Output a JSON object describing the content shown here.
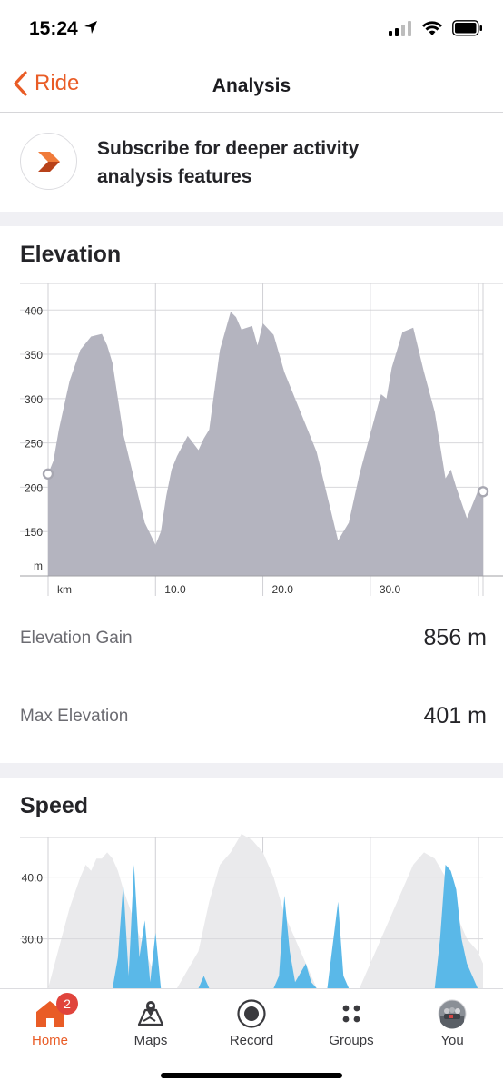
{
  "status": {
    "time": "15:24"
  },
  "nav": {
    "back_label": "Ride",
    "title": "Analysis"
  },
  "subscribe": {
    "text": "Subscribe for deeper activity analysis features"
  },
  "elevation": {
    "title": "Elevation",
    "stats": [
      {
        "label": "Elevation Gain",
        "value": "856 m"
      },
      {
        "label": "Max Elevation",
        "value": "401 m"
      }
    ]
  },
  "speed": {
    "title": "Speed"
  },
  "tabs": [
    {
      "label": "Home",
      "icon": "home-icon",
      "active": true,
      "badge": "2"
    },
    {
      "label": "Maps",
      "icon": "maps-icon",
      "active": false
    },
    {
      "label": "Record",
      "icon": "record-icon",
      "active": false
    },
    {
      "label": "Groups",
      "icon": "groups-icon",
      "active": false
    },
    {
      "label": "You",
      "icon": "avatar-icon",
      "active": false
    }
  ],
  "colors": {
    "accent": "#e95c26",
    "elevation_fill": "#b4b4bf",
    "speed_fill": "#5ab8e8",
    "speed_bg_fill": "#eaeaec",
    "badge": "#e0443c"
  },
  "chart_data": [
    {
      "type": "area",
      "title": "Elevation",
      "xlabel": "km",
      "ylabel": "m",
      "x_ticks": [
        "km",
        "10.0",
        "20.0",
        "30.0"
      ],
      "y_ticks": [
        150,
        200,
        250,
        300,
        350,
        400
      ],
      "xlim": [
        0,
        40.5
      ],
      "ylim": [
        100,
        430
      ],
      "grid": true,
      "x": [
        0,
        0.5,
        1,
        2,
        3,
        4,
        5,
        5.5,
        6,
        6.5,
        7,
        8,
        9,
        10,
        10.5,
        11,
        11.5,
        12,
        13,
        14,
        14.5,
        15,
        16,
        17,
        17.5,
        18,
        19,
        19.5,
        20,
        21,
        22,
        23,
        24,
        25,
        26,
        27,
        28,
        29,
        30,
        31,
        31.5,
        32,
        33,
        34,
        35,
        36,
        37,
        37.5,
        38,
        39,
        40,
        40.5
      ],
      "values": [
        215,
        230,
        265,
        320,
        355,
        370,
        373,
        360,
        340,
        300,
        260,
        210,
        160,
        135,
        150,
        190,
        220,
        235,
        258,
        242,
        255,
        265,
        355,
        398,
        392,
        378,
        382,
        360,
        385,
        372,
        330,
        300,
        270,
        240,
        190,
        140,
        160,
        215,
        260,
        305,
        300,
        335,
        375,
        380,
        330,
        285,
        210,
        220,
        200,
        165,
        195,
        195
      ]
    },
    {
      "type": "area",
      "title": "Speed",
      "x_ticks": [],
      "y_ticks": [
        30.0,
        40.0
      ],
      "xlim": [
        0,
        40.5
      ],
      "ylim": [
        22,
        47
      ],
      "grid": true,
      "series": [
        {
          "x": [
            0,
            2,
            3,
            3.5,
            4,
            4.5,
            5,
            5.5,
            6,
            6.5,
            7,
            8,
            9,
            10.5,
            11,
            12,
            14,
            15,
            16,
            17,
            18,
            19,
            20,
            21,
            22,
            23,
            24,
            25,
            26,
            27,
            28,
            29,
            30,
            31,
            32,
            33,
            34,
            35,
            36,
            37,
            38,
            39,
            40,
            40.5
          ],
          "values": [
            22,
            35,
            40,
            42,
            41,
            43,
            43,
            44,
            43,
            41,
            38,
            33,
            28,
            22,
            22,
            22,
            28,
            36,
            42,
            44,
            47,
            46,
            44,
            40,
            34,
            30,
            26,
            22,
            22,
            22,
            22,
            22,
            26,
            30,
            34,
            38,
            42,
            44,
            43,
            40,
            34,
            30,
            28,
            26
          ]
        },
        {
          "x": [
            0,
            6,
            6.5,
            7,
            7.5,
            8,
            8.5,
            9,
            9.5,
            10,
            10.5,
            11,
            14,
            14.5,
            15,
            21,
            21.5,
            22,
            22.5,
            23,
            24,
            24.5,
            25,
            26,
            27,
            27.5,
            28,
            30,
            36,
            36.5,
            37,
            37.5,
            38,
            38.5,
            39,
            39.5,
            40,
            40.5
          ],
          "values": [
            22,
            22,
            27,
            39,
            24,
            42,
            27,
            33,
            23,
            31,
            22,
            22,
            22,
            24,
            22,
            22,
            24,
            37,
            28,
            23,
            26,
            23,
            22,
            22,
            36,
            24,
            22,
            22,
            22,
            30,
            42,
            41,
            38,
            30,
            26,
            24,
            22,
            22
          ]
        }
      ]
    }
  ]
}
